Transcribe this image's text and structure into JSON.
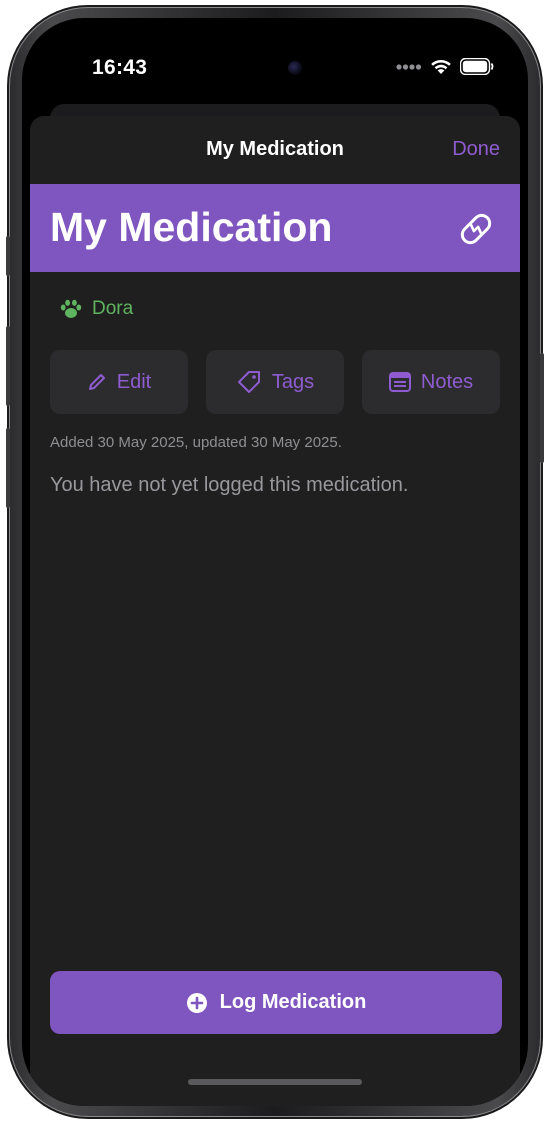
{
  "status_bar": {
    "time": "16:43"
  },
  "nav": {
    "title": "My Medication",
    "done_label": "Done"
  },
  "header": {
    "title": "My Medication",
    "icon": "pill-icon",
    "background_color": "#7f56bf"
  },
  "pet": {
    "icon": "paw-icon",
    "name": "Dora",
    "color": "#5fb55f"
  },
  "actions": [
    {
      "icon": "pencil-icon",
      "label": "Edit"
    },
    {
      "icon": "tag-icon",
      "label": "Tags"
    },
    {
      "icon": "notes-icon",
      "label": "Notes"
    }
  ],
  "meta_text": "Added 30 May 2025, updated 30 May 2025.",
  "empty_message": "You have not yet logged this medication.",
  "log_button": {
    "icon": "plus-circle-icon",
    "label": "Log Medication"
  },
  "accent_color": "#8e5cd0"
}
